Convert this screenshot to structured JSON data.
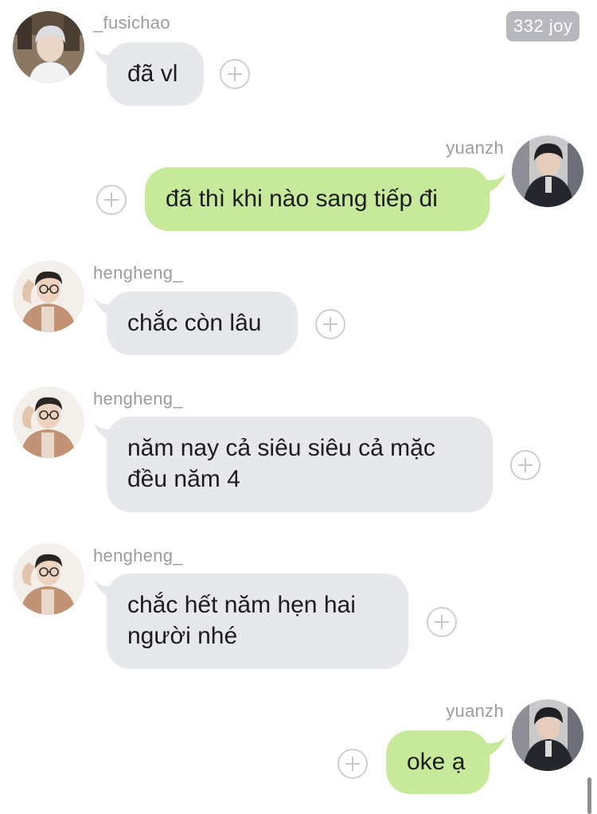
{
  "badge": {
    "text": "332 joy"
  },
  "messages": [
    {
      "sender": "_fusichao",
      "direction": "incoming",
      "lines": [
        "đã vl"
      ]
    },
    {
      "sender": "yuanzh",
      "direction": "outgoing",
      "lines": [
        "đã thì khi nào sang tiếp đi"
      ]
    },
    {
      "sender": "hengheng_",
      "direction": "incoming",
      "lines": [
        "chắc còn lâu"
      ]
    },
    {
      "sender": "hengheng_",
      "direction": "incoming",
      "lines": [
        "năm nay cả siêu siêu cả mặc",
        "đều năm 4"
      ]
    },
    {
      "sender": "hengheng_",
      "direction": "incoming",
      "lines": [
        "chắc hết năm hẹn hai",
        "người nhé"
      ]
    },
    {
      "sender": "yuanzh",
      "direction": "outgoing",
      "lines": [
        "oke ạ"
      ]
    }
  ],
  "icons": {
    "react": "plus-circle-icon",
    "avatar": "user-avatar-photo"
  },
  "colors": {
    "incoming_bubble": "#e6e8ec",
    "outgoing_bubble": "#c7ea9a",
    "sender_name": "#9c9c9c",
    "badge_background": "#b7b9be",
    "react_icon": "#cfcfcf"
  }
}
